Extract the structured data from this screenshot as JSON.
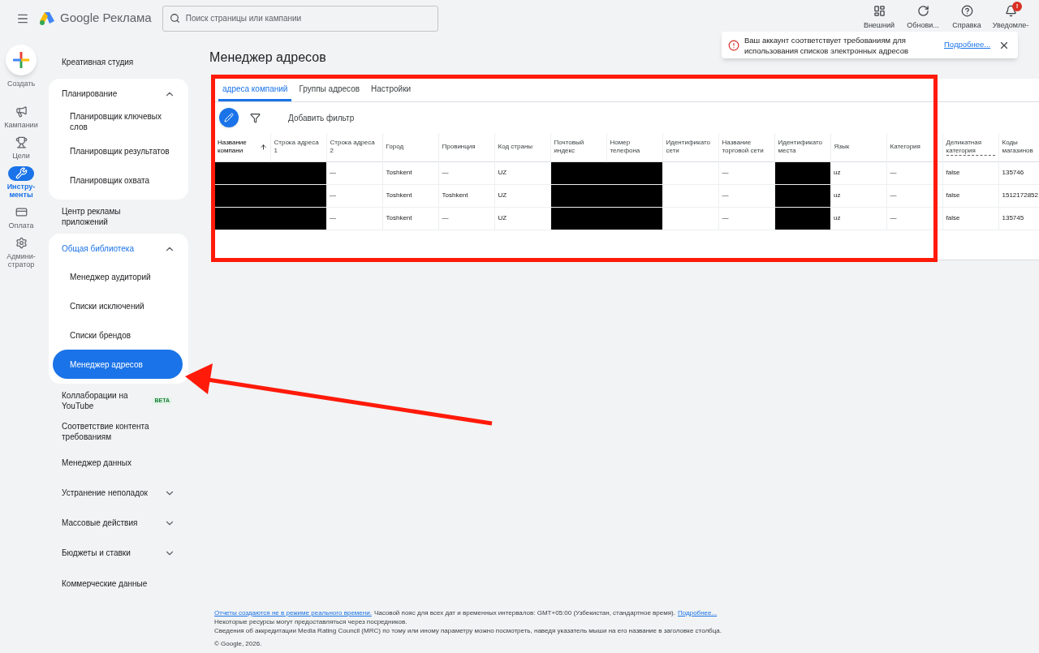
{
  "header": {
    "brand": "Google Реклама",
    "search": {
      "placeholder": "Поиск страницы или кампании"
    },
    "actions": [
      {
        "kind": "appearance",
        "label": "Внешний"
      },
      {
        "kind": "refresh",
        "label": "Обнови..."
      },
      {
        "kind": "help",
        "label": "Справка"
      },
      {
        "kind": "bell",
        "label": "Уведомле-",
        "badge": "!"
      }
    ]
  },
  "toast": {
    "text": "Ваш аккаунт соответствует требованиям для использования списков электронных адресов",
    "link": "Подробнее..."
  },
  "rail": [
    {
      "kind": "create",
      "label": "Создать"
    },
    {
      "kind": "campaigns",
      "label": "Кампании",
      "selected": false
    },
    {
      "kind": "goals",
      "label": "Цели",
      "selected": false
    },
    {
      "kind": "tools",
      "label": "Инстру-менты",
      "selected": true
    },
    {
      "kind": "billing",
      "label": "Оплата",
      "selected": false
    },
    {
      "kind": "admin",
      "label": "Админи-стратор",
      "selected": false
    }
  ],
  "nav": [
    {
      "kind": "link",
      "label": "Креативная студия"
    },
    {
      "kind": "section",
      "label": "Планирование",
      "expanded": true,
      "active": false,
      "children": [
        {
          "label": "Планировщик ключевых слов",
          "selected": false
        },
        {
          "label": "Планировщик результатов",
          "selected": false
        },
        {
          "label": "Планировщик охвата",
          "selected": false
        }
      ]
    },
    {
      "kind": "link",
      "label": "Центр рекламы приложений"
    },
    {
      "kind": "section",
      "label": "Общая библиотека",
      "expanded": true,
      "active": true,
      "children": [
        {
          "label": "Менеджер аудиторий",
          "selected": false
        },
        {
          "label": "Списки исключений",
          "selected": false
        },
        {
          "label": "Списки брендов",
          "selected": false
        },
        {
          "label": "Менеджер адресов",
          "selected": true
        }
      ]
    },
    {
      "kind": "link",
      "label": "Коллаборации на YouTube",
      "badge": "BETA"
    },
    {
      "kind": "link",
      "label": "Соответствие контента требованиям"
    },
    {
      "kind": "link",
      "label": "Менеджер данных"
    },
    {
      "kind": "section",
      "label": "Устранение неполадок",
      "expanded": false,
      "active": false
    },
    {
      "kind": "section",
      "label": "Массовые действия",
      "expanded": false,
      "active": false
    },
    {
      "kind": "section",
      "label": "Бюджеты и ставки",
      "expanded": false,
      "active": false
    },
    {
      "kind": "link",
      "label": "Коммерческие данные"
    }
  ],
  "page": {
    "title": "Менеджер адресов",
    "tabs": [
      {
        "label": "адреса компаний",
        "selected": true
      },
      {
        "label": "Группы адресов",
        "selected": false
      },
      {
        "label": "Настройки",
        "selected": false
      }
    ],
    "add_filter": "Добавить фильтр",
    "table": {
      "columns": [
        {
          "label": "Название компани",
          "sorted": true
        },
        {
          "label": "Строка адреса 1",
          "sorted": false
        },
        {
          "label": "Строка адреса 2",
          "sorted": false
        },
        {
          "label": "Город",
          "sorted": false
        },
        {
          "label": "Провинция",
          "sorted": false
        },
        {
          "label": "Код страны",
          "sorted": false
        },
        {
          "label": "Почтовый индекс",
          "sorted": false
        },
        {
          "label": "Номер телефона",
          "sorted": false
        },
        {
          "label": "Идентификато сети",
          "sorted": false
        },
        {
          "label": "Название торговой сети",
          "sorted": false
        },
        {
          "label": "Идентификато места",
          "sorted": false
        },
        {
          "label": "Язык",
          "sorted": false
        },
        {
          "label": "Категория",
          "sorted": false
        },
        {
          "label": "Деликатная категория",
          "sorted": false,
          "dotted": true
        },
        {
          "label": "Коды магазинов",
          "sorted": false
        }
      ],
      "rows": [
        {
          "cells": [
            {
              "kind": "redacted"
            },
            {
              "kind": "redacted"
            },
            {
              "text": "—"
            },
            {
              "text": "Toshkent"
            },
            {
              "text": "—"
            },
            {
              "text": "UZ"
            },
            {
              "kind": "redacted"
            },
            {
              "kind": "redacted"
            },
            {
              "kind": "blank"
            },
            {
              "text": "—"
            },
            {
              "kind": "redacted"
            },
            {
              "text": "uz"
            },
            {
              "text": "—"
            },
            {
              "text": "false"
            },
            {
              "text": "135746"
            }
          ]
        },
        {
          "cells": [
            {
              "kind": "redacted"
            },
            {
              "kind": "redacted"
            },
            {
              "text": "—"
            },
            {
              "text": "Toshkent"
            },
            {
              "text": "Toshkent"
            },
            {
              "text": "UZ"
            },
            {
              "kind": "redacted"
            },
            {
              "kind": "redacted"
            },
            {
              "kind": "blank"
            },
            {
              "text": "—"
            },
            {
              "kind": "redacted"
            },
            {
              "text": "uz"
            },
            {
              "text": "—"
            },
            {
              "text": "false"
            },
            {
              "text": "1512172852"
            }
          ]
        },
        {
          "cells": [
            {
              "kind": "redacted"
            },
            {
              "kind": "redacted"
            },
            {
              "text": "—"
            },
            {
              "text": "Toshkent"
            },
            {
              "text": "—"
            },
            {
              "text": "UZ"
            },
            {
              "kind": "redacted"
            },
            {
              "kind": "redacted"
            },
            {
              "kind": "blank"
            },
            {
              "text": "—"
            },
            {
              "kind": "redacted"
            },
            {
              "text": "uz"
            },
            {
              "text": "—"
            },
            {
              "text": "false"
            },
            {
              "text": "135745"
            }
          ]
        }
      ]
    }
  },
  "footer": {
    "link_start": "Отчеты создаются не в режиме реального времени.",
    "text": "Часовой пояс для всех дат и временных интервалов: GMT+05:00 (Узбекистан, стандартное время).",
    "link_end": "Подробнее...",
    "lines": [
      "Некоторые ресурсы могут предоставляться через посредников.",
      "Сведения об аккредитации Media Rating Council (MRC) по тому или иному параметру можно посмотреть, наведя указатель мыши на его название в заголовке столбца."
    ],
    "copyright": "© Google, 2026."
  }
}
